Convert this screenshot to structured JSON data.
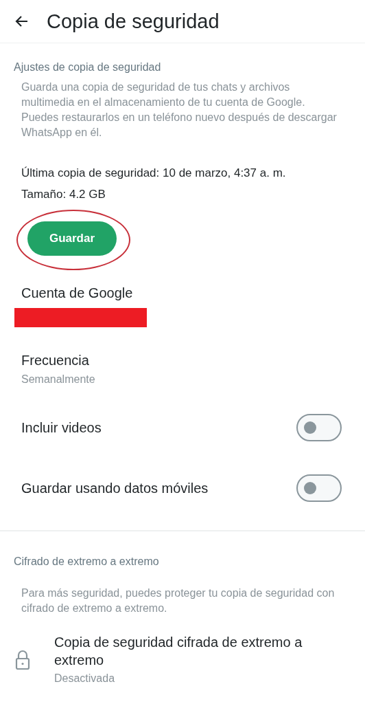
{
  "header": {
    "title": "Copia de seguridad"
  },
  "backup_settings": {
    "heading": "Ajustes de copia de seguridad",
    "description": "Guarda una copia de seguridad de tus chats y archivos multimedia en el almacenamiento de tu cuenta de Google. Puedes restaurarlos en un teléfono nuevo después de descargar WhatsApp en él.",
    "last_backup": "Última copia de seguridad: 10 de marzo, 4:37 a. m.",
    "size": "Tamaño: 4.2 GB",
    "save_button": {
      "label": "Guardar",
      "circled": true
    }
  },
  "settings": [
    {
      "kind": "account",
      "title": "Cuenta de Google",
      "redacted": true
    },
    {
      "kind": "value",
      "title": "Frecuencia",
      "subtitle": "Semanalmente"
    },
    {
      "kind": "toggle",
      "title": "Incluir videos",
      "on": false
    },
    {
      "kind": "toggle",
      "title": "Guardar usando datos móviles",
      "on": false
    }
  ],
  "encryption": {
    "heading": "Cifrado de extremo a extremo",
    "description": "Para más seguridad, puedes proteger tu copia de seguridad con cifrado de extremo a extremo.",
    "item": {
      "title": "Copia de seguridad cifrada de extremo a extremo",
      "subtitle": "Desactivada"
    }
  }
}
